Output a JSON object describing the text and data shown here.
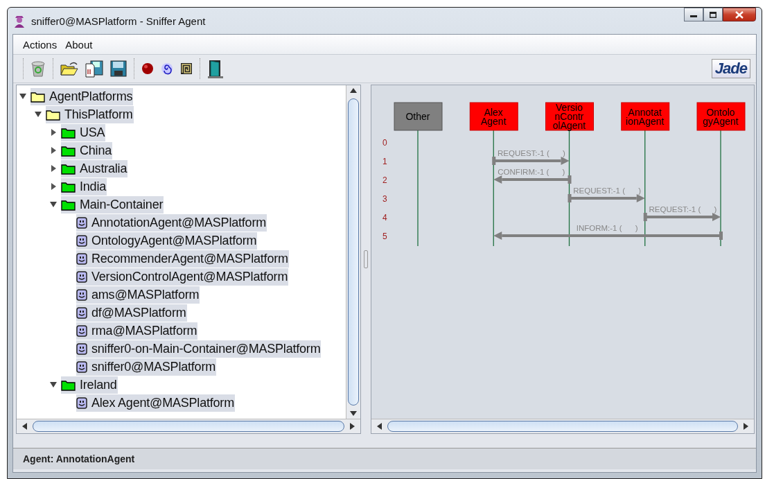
{
  "window": {
    "title": "sniffer0@MASPlatform - Sniffer Agent"
  },
  "menu": [
    "Actions",
    "About"
  ],
  "toolbar": {
    "logo_text": "Jade"
  },
  "tree": [
    {
      "label": "AgentPlatforms",
      "kind": "platform",
      "expanded": true,
      "selected": true,
      "children": [
        {
          "label": "ThisPlatform",
          "kind": "platform",
          "expanded": true,
          "selected": true,
          "children": [
            {
              "label": "USA",
              "kind": "container",
              "expanded": false,
              "selected": true
            },
            {
              "label": "China",
              "kind": "container",
              "expanded": false,
              "selected": true
            },
            {
              "label": "Australia",
              "kind": "container",
              "expanded": false,
              "selected": true
            },
            {
              "label": "India",
              "kind": "container",
              "expanded": false,
              "selected": true
            },
            {
              "label": "Main-Container",
              "kind": "container",
              "expanded": true,
              "selected": true,
              "children": [
                {
                  "label": "AnnotationAgent@MASPlatform",
                  "kind": "agent",
                  "selected": true
                },
                {
                  "label": "OntologyAgent@MASPlatform",
                  "kind": "agent",
                  "selected": true
                },
                {
                  "label": "RecommenderAgent@MASPlatform",
                  "kind": "agent",
                  "selected": true
                },
                {
                  "label": "VersionControlAgent@MASPlatform",
                  "kind": "agent",
                  "selected": true
                },
                {
                  "label": "ams@MASPlatform",
                  "kind": "agent",
                  "selected": true
                },
                {
                  "label": "df@MASPlatform",
                  "kind": "agent",
                  "selected": true
                },
                {
                  "label": "rma@MASPlatform",
                  "kind": "agent",
                  "selected": true
                },
                {
                  "label": "sniffer0-on-Main-Container@MASPlatform",
                  "kind": "agent",
                  "selected": true
                },
                {
                  "label": "sniffer0@MASPlatform",
                  "kind": "agent",
                  "selected": true
                }
              ]
            },
            {
              "label": "Ireland",
              "kind": "container",
              "expanded": true,
              "selected": true,
              "children": [
                {
                  "label": "Alex Agent@MASPlatform",
                  "kind": "agent",
                  "selected": true
                }
              ]
            }
          ]
        }
      ]
    }
  ],
  "diagram": {
    "row_numbers": [
      "0",
      "1",
      "2",
      "3",
      "4",
      "5"
    ],
    "agents": [
      {
        "lines": [
          "Other"
        ],
        "kind": "other"
      },
      {
        "lines": [
          "Alex",
          "Agent"
        ],
        "kind": "agent"
      },
      {
        "lines": [
          "Versio",
          "nContr",
          "olAgent"
        ],
        "kind": "agent"
      },
      {
        "lines": [
          "Annotat",
          "ionAgent"
        ],
        "kind": "agent"
      },
      {
        "lines": [
          "Ontolo",
          "gyAgent"
        ],
        "kind": "agent"
      }
    ],
    "messages": [
      {
        "label": "REQUEST:-1 (      )",
        "lanes": [
          {
            "kind": "none"
          },
          {
            "kind": "sender"
          },
          {
            "kind": "receiver"
          },
          {
            "kind": "none"
          },
          {
            "kind": "none"
          }
        ]
      },
      {
        "label": "CONFIRM:-1 (      )",
        "lanes": [
          {
            "kind": "none"
          },
          {
            "kind": "receiver"
          },
          {
            "kind": "sender"
          },
          {
            "kind": "none"
          },
          {
            "kind": "none"
          }
        ]
      },
      {
        "label": "REQUEST:-1 (      )",
        "lanes": [
          {
            "kind": "none"
          },
          {
            "kind": "none"
          },
          {
            "kind": "sender"
          },
          {
            "kind": "receiver"
          },
          {
            "kind": "none"
          }
        ]
      },
      {
        "label": "REQUEST:-1 (      )",
        "lanes": [
          {
            "kind": "none"
          },
          {
            "kind": "none"
          },
          {
            "kind": "none"
          },
          {
            "kind": "sender"
          },
          {
            "kind": "receiver"
          }
        ]
      },
      {
        "label": "INFORM:-1 (      )",
        "lanes": [
          {
            "kind": "none"
          },
          {
            "kind": "receiver"
          },
          {
            "kind": "none"
          },
          {
            "kind": "none"
          },
          {
            "kind": "sender"
          }
        ]
      }
    ]
  },
  "status_bar": "Agent: AnnotationAgent"
}
